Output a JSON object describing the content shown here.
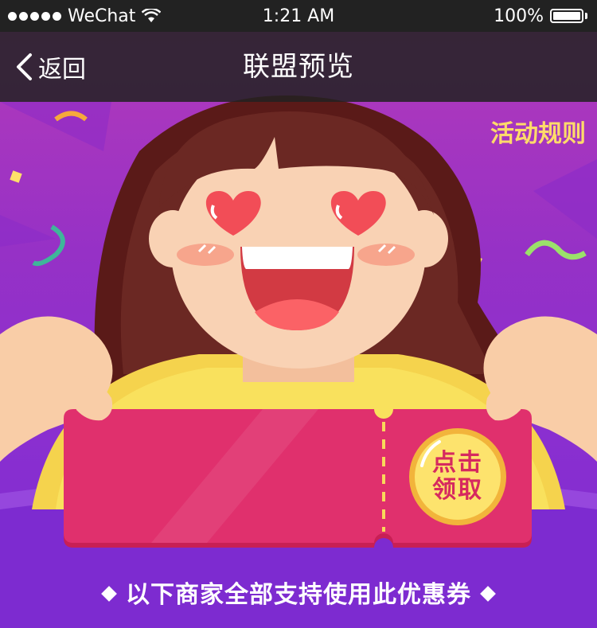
{
  "status_bar": {
    "carrier": "WeChat",
    "time": "1:21 AM",
    "battery": "100%"
  },
  "nav": {
    "back_label": "返回",
    "title": "联盟预览"
  },
  "banner": {
    "rules_label": "活动规则",
    "coupon_button_line1": "点击",
    "coupon_button_line2": "领取"
  },
  "footer": {
    "caption": "以下商家全部支持使用此优惠券"
  },
  "colors": {
    "accent_yellow": "#ffdb6a",
    "coupon_pink": "#e0306d",
    "background_purple": "#9631c6"
  },
  "icons": {
    "back": "chevron-left-icon",
    "wifi": "wifi-icon",
    "battery": "battery-icon"
  }
}
